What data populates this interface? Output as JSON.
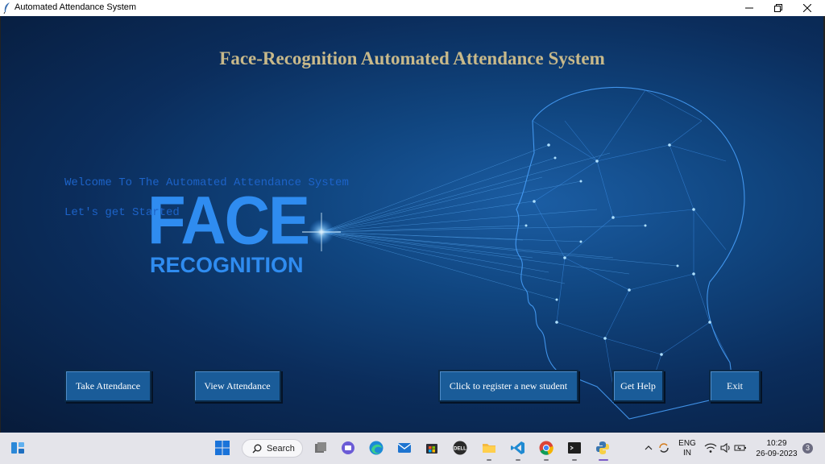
{
  "window": {
    "title": "Automated Attendance System",
    "controls": [
      "minimize-icon",
      "restore-icon",
      "close-icon"
    ]
  },
  "main": {
    "header_title": "Face-Recognition Automated Attendance System",
    "welcome_text": "Welcome To The Automated Attendance System",
    "get_started_text": "Let's get Started",
    "logo": {
      "big": "FACE",
      "small": "RECOGNITION"
    },
    "buttons": {
      "take_attendance": "Take Attendance",
      "view_attendance": "View Attendance",
      "register": "Click to register a new student",
      "get_help": "Get Help",
      "exit": "Exit"
    },
    "colors": {
      "title": "#c8b98a",
      "welcome": "#1d63c8",
      "logo": "#2f8cf0",
      "button": "#1a5c99"
    }
  },
  "taskbar": {
    "search_label": "Search",
    "icons": [
      "widgets-icon",
      "start-icon",
      "search-icon",
      "task-view-icon",
      "teams-chat-icon",
      "edge-icon",
      "mail-icon",
      "store-icon",
      "dell-icon",
      "file-explorer-icon",
      "vscode-icon",
      "chrome-icon",
      "terminal-icon",
      "python-icon"
    ],
    "tray": {
      "language_line1": "ENG",
      "language_line2": "IN",
      "time": "10:29",
      "date": "26-09-2023",
      "notification_count": "3"
    }
  }
}
